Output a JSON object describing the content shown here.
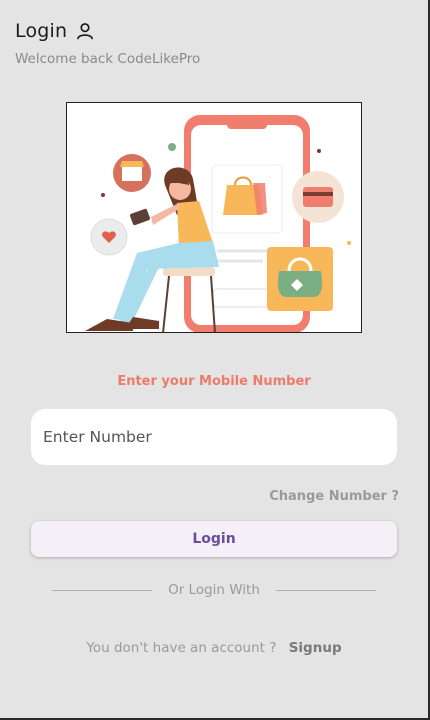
{
  "header": {
    "title": "Login",
    "subtitle": "Welcome back CodeLikePro"
  },
  "icons": {
    "title_icon": "user-outline-icon"
  },
  "form": {
    "prompt": "Enter your Mobile Number",
    "number_placeholder": "Enter Number",
    "change_number_label": "Change Number ?",
    "login_label": "Login"
  },
  "alt_login": {
    "divider_text": "Or Login With"
  },
  "signup": {
    "question": "You don't have an account ?",
    "link_label": "Signup"
  },
  "colors": {
    "background": "#e4e4e4",
    "accent": "#ec7b6b",
    "button_bg": "#f5eff7",
    "button_text": "#6a4c9c"
  }
}
